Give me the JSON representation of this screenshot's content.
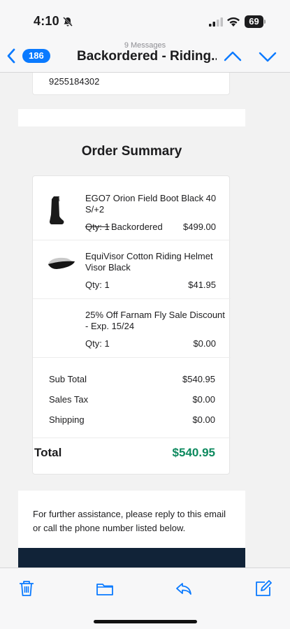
{
  "status_bar": {
    "time": "4:10",
    "battery": "69"
  },
  "nav": {
    "back_count": "186",
    "subtitle": "9 Messages",
    "title": "Backordered - Riding...",
    "accent": "#0a7aff"
  },
  "email": {
    "phone": "9255184302",
    "summary_title": "Order Summary",
    "items": [
      {
        "name": "EGO7 Orion Field Boot Black 40 S/+2",
        "qty": "Qty: 1",
        "status": "Backordered",
        "price": "$499.00"
      },
      {
        "name": "EquiVisor Cotton Riding Helmet Visor Black",
        "qty": "Qty: 1",
        "price": "$41.95"
      },
      {
        "name": "25% Off Farnam Fly Sale Discount - Exp. 15/24",
        "qty": "Qty: 1",
        "price": "$0.00"
      }
    ],
    "totals": [
      {
        "label": "Sub Total",
        "value": "$540.95"
      },
      {
        "label": "Sales Tax",
        "value": "$0.00"
      },
      {
        "label": "Shipping",
        "value": "$0.00"
      }
    ],
    "grand_total": {
      "label": "Total",
      "value": "$540.95",
      "color": "#0e8a5f"
    },
    "assist_text": "For further assistance, please reply to this email or call the phone number listed below."
  },
  "toolbar": {
    "icons": [
      "trash-icon",
      "folder-icon",
      "reply-icon",
      "compose-icon"
    ]
  }
}
